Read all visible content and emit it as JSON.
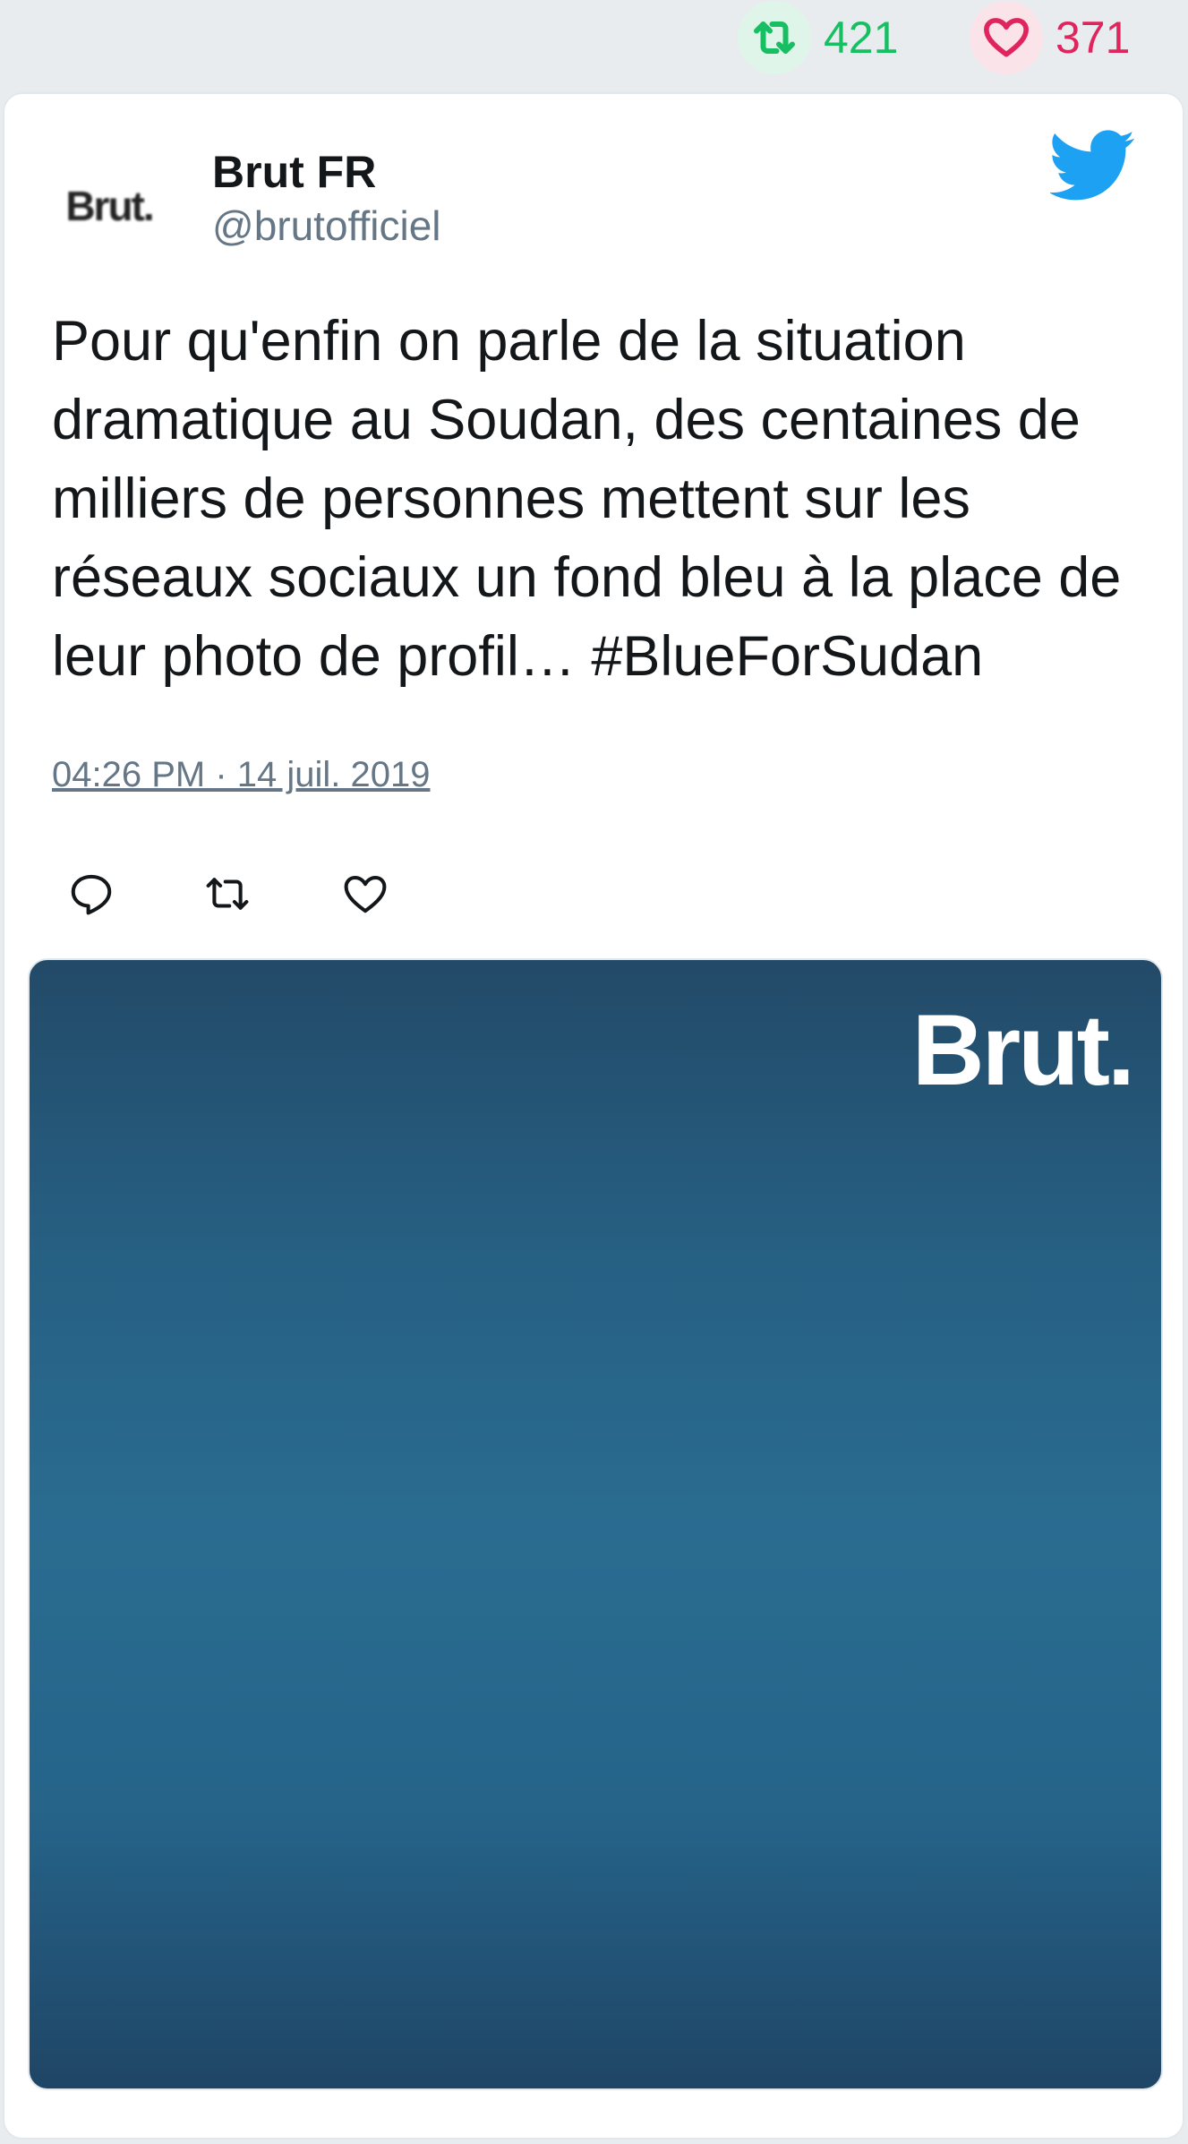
{
  "stats": {
    "retweets": "421",
    "likes": "371",
    "colors": {
      "retweet": "#17bf63",
      "like": "#e0245e"
    }
  },
  "tweet": {
    "author": {
      "name": "Brut FR",
      "handle": "@brutofficiel",
      "avatar_text": "Brut."
    },
    "text": "Pour qu'enfin on parle de la situation dramatique au Soudan, des centaines de milliers de personnes mettent sur les réseaux sociaux un fond bleu à la place de leur photo de profil… #BlueForSudan",
    "timestamp": "04:26 PM · 14 juil. 2019",
    "media": {
      "logo_text": "Brut."
    },
    "icons": [
      "twitter-bird-icon",
      "reply-icon",
      "retweet-icon",
      "like-icon"
    ],
    "brand_color": "#1da1f2"
  }
}
